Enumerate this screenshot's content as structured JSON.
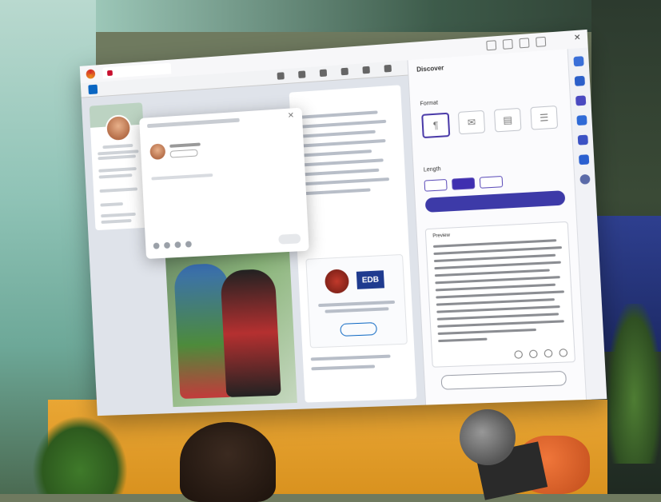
{
  "scene": {
    "description_free": true
  },
  "browser": {
    "tab_label": "",
    "window_controls": "✕"
  },
  "linkedin": {
    "edb_logo_text": "EDB",
    "follow_label": ""
  },
  "modal": {
    "close_glyph": "✕"
  },
  "copilot": {
    "header": "Discover",
    "tabs": [
      {
        "label": ""
      },
      {
        "label": ""
      },
      {
        "label": ""
      },
      {
        "label": ""
      }
    ],
    "format_section_label": "Format",
    "formats": [
      {
        "label": "",
        "icon": "¶"
      },
      {
        "label": "",
        "icon": "✉"
      },
      {
        "label": "",
        "icon": "▤"
      },
      {
        "label": "",
        "icon": "☰"
      }
    ],
    "length_section_label": "Length",
    "lengths": [
      {
        "label": ""
      },
      {
        "label": ""
      },
      {
        "label": ""
      }
    ],
    "generate_label": "",
    "preview_label": "Preview",
    "add_label": ""
  }
}
